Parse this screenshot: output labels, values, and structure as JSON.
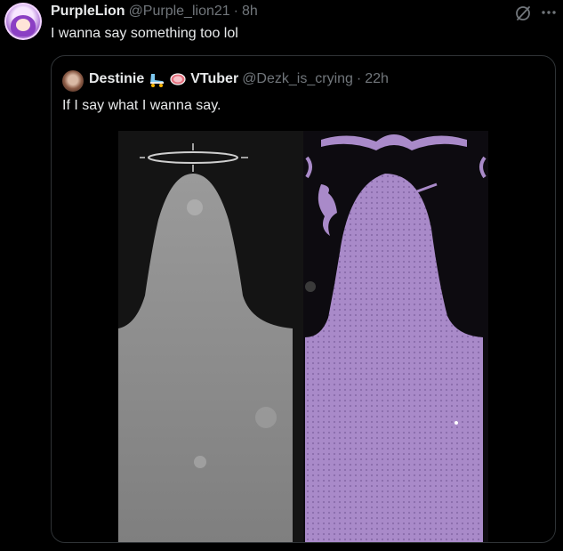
{
  "tweet": {
    "author_name": "PurpleLion",
    "handle": "@Purple_lion21",
    "separator": "·",
    "time": "8h",
    "text": "I wanna say something too lol",
    "icons": {
      "grok": "grok-icon",
      "more": "more-icon"
    }
  },
  "quote": {
    "author_name": "Destinie",
    "emoji_1": "roller-skate-emoji",
    "emoji_2": "meat-emoji",
    "author_suffix": "VTuber",
    "handle": "@Dezk_is_crying",
    "separator": "·",
    "time": "22h",
    "text": "If I say what I wanna say."
  },
  "colors": {
    "background": "#000000",
    "text_primary": "#e7e9ea",
    "text_secondary": "#71767b",
    "border": "#2f3336",
    "purple_silhouette": "#a98ac9",
    "gray_silhouette": "#8e8e8e"
  }
}
